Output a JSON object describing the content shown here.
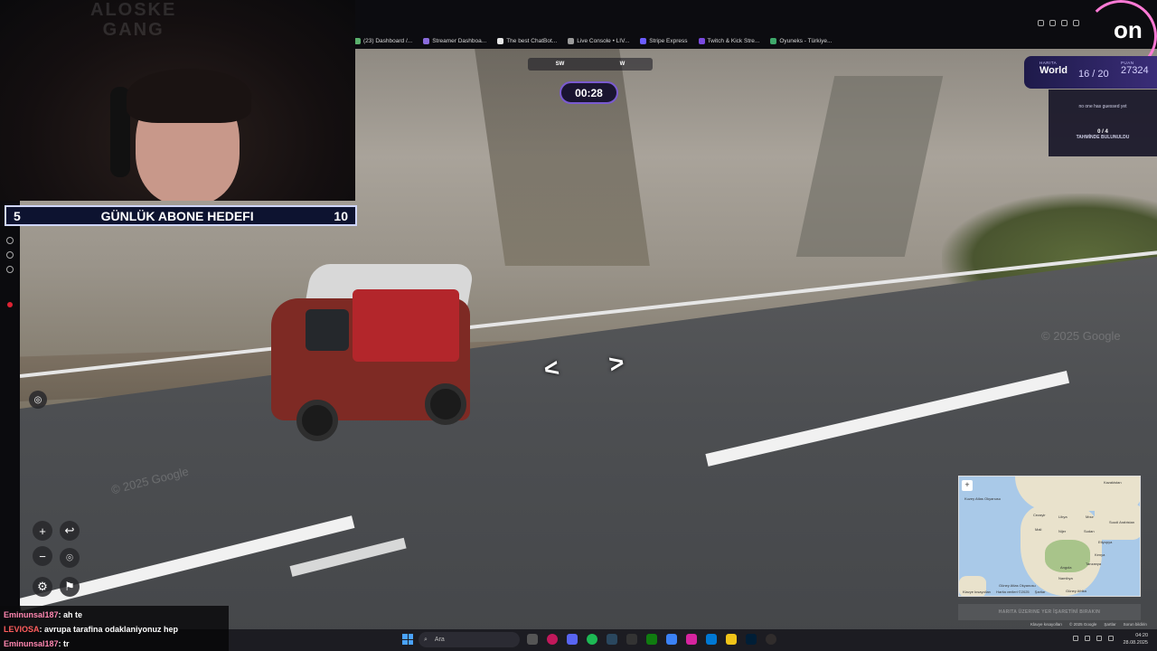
{
  "browser": {
    "bookmarks": [
      {
        "label": "(23) Dashboard /..."
      },
      {
        "label": "Streamer Dashboa..."
      },
      {
        "label": "The best ChatBot..."
      },
      {
        "label": "Live Console • LIV..."
      },
      {
        "label": "Stripe Express"
      },
      {
        "label": "Twitch & Kick Stre..."
      },
      {
        "label": "Oyuneks - Türkiye..."
      }
    ]
  },
  "compass": {
    "left": "SW",
    "right": "W"
  },
  "timer": "00:28",
  "webcam": {
    "logo_line1": "ALOSKE",
    "logo_line2": "GANG"
  },
  "subgoal": {
    "current": "5",
    "title": "GÜNLÜK ABONE HEDEFI",
    "target": "10"
  },
  "game": {
    "logo": "on",
    "map_label": "HARITA",
    "map_value": "World",
    "round_value": "16 / 20",
    "points_label": "PUAN",
    "points_value": "27324",
    "no_guess": "no one has guessed yet",
    "guess_count": "0 / 4",
    "guess_label": "TAHMİNDE BULUNULDU"
  },
  "minimap": {
    "place_button": "HARITA ÜZERINE YER İŞARETİNİ BIRAKIN",
    "ocean_north": "Kuzey Atlas Okyanusu",
    "ocean_south": "Güney Atlas Okyanusu",
    "labels": [
      "Kazakistan",
      "Cezayir",
      "Libya",
      "Mısır",
      "Suudi Arabistan",
      "Mali",
      "Nijer",
      "Sudan",
      "Etiyopya",
      "Kenya",
      "Tanzanya",
      "Angola",
      "Namibya",
      "Güney Afrika"
    ],
    "attrib": [
      "Klavye kısayolları",
      "Harita verileri ©2025",
      "Şartlar"
    ],
    "footer": [
      "Klavye kısayolları",
      "© 2025 Google",
      "Şartlar",
      "Sorun bildirin"
    ]
  },
  "street": {
    "watermark": "© 2025 Google"
  },
  "chat": [
    {
      "user": "Eminunsal187",
      "msg": ": ah te"
    },
    {
      "user": "LEVIOSA",
      "msg": ": avrupa tarafina odaklaniyonuz hep"
    },
    {
      "user": "Eminunsal187",
      "msg": ": tr"
    }
  ],
  "taskbar": {
    "search": "Ara",
    "time": "04:20",
    "date": "28.08.2025"
  },
  "colors": {
    "timer_border": "#7a5ad0",
    "goal_bg": "#0d1330",
    "panel": "#3a2d78",
    "chat_user": "#ff86b0"
  }
}
